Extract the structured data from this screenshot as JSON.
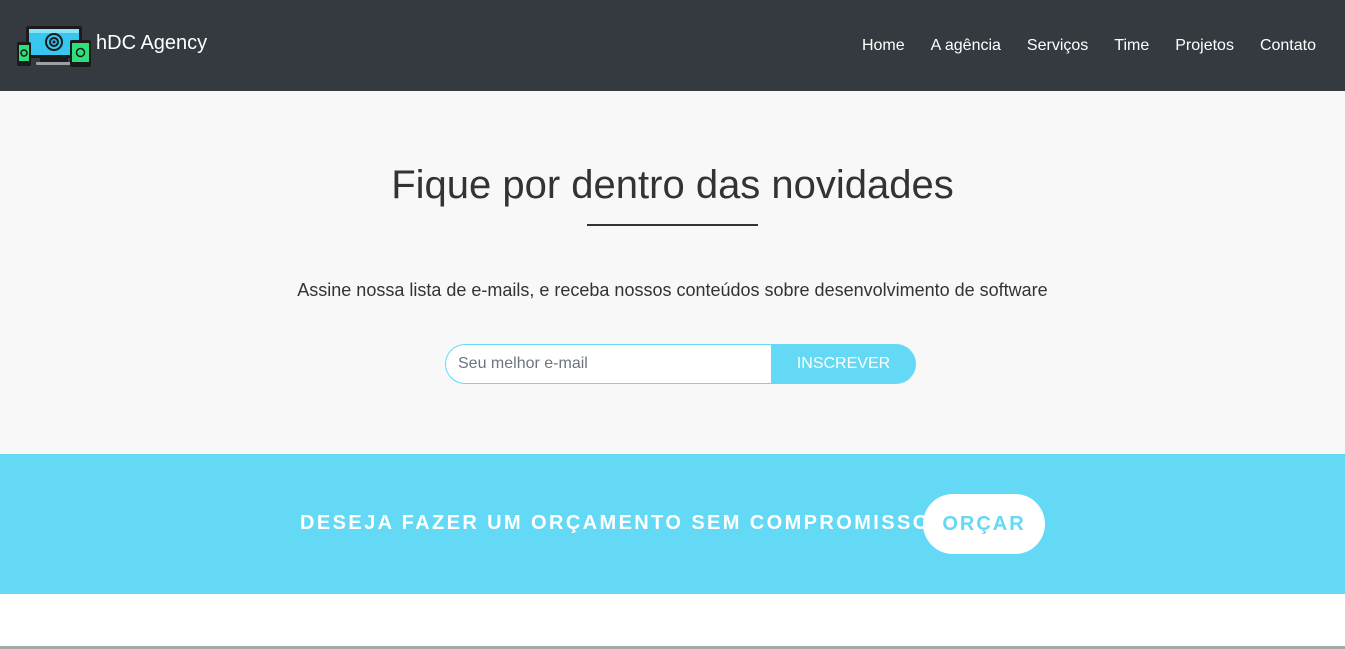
{
  "navbar": {
    "brand_logo_icon": "devices-logo-icon",
    "brand_name": "hDC Agency",
    "items": [
      {
        "label": "Home"
      },
      {
        "label": "A agência"
      },
      {
        "label": "Serviços"
      },
      {
        "label": "Time"
      },
      {
        "label": "Projetos"
      },
      {
        "label": "Contato"
      }
    ]
  },
  "newsletter": {
    "title": "Fique por dentro das novidades",
    "description": "Assine nossa lista de e-mails, e receba nossos conteúdos sobre desenvolvimento de software",
    "email_placeholder": "Seu melhor e-mail",
    "email_value": "",
    "subscribe_label": "INSCREVER"
  },
  "cta": {
    "text": "DESEJA FAZER UM ORÇAMENTO SEM COMPROMISSO?",
    "button_label": "ORÇAR"
  },
  "colors": {
    "navbar_bg": "#343a40",
    "accent": "#63d9f6",
    "section_bg": "#f8f8f8",
    "text_dark": "#333333"
  }
}
